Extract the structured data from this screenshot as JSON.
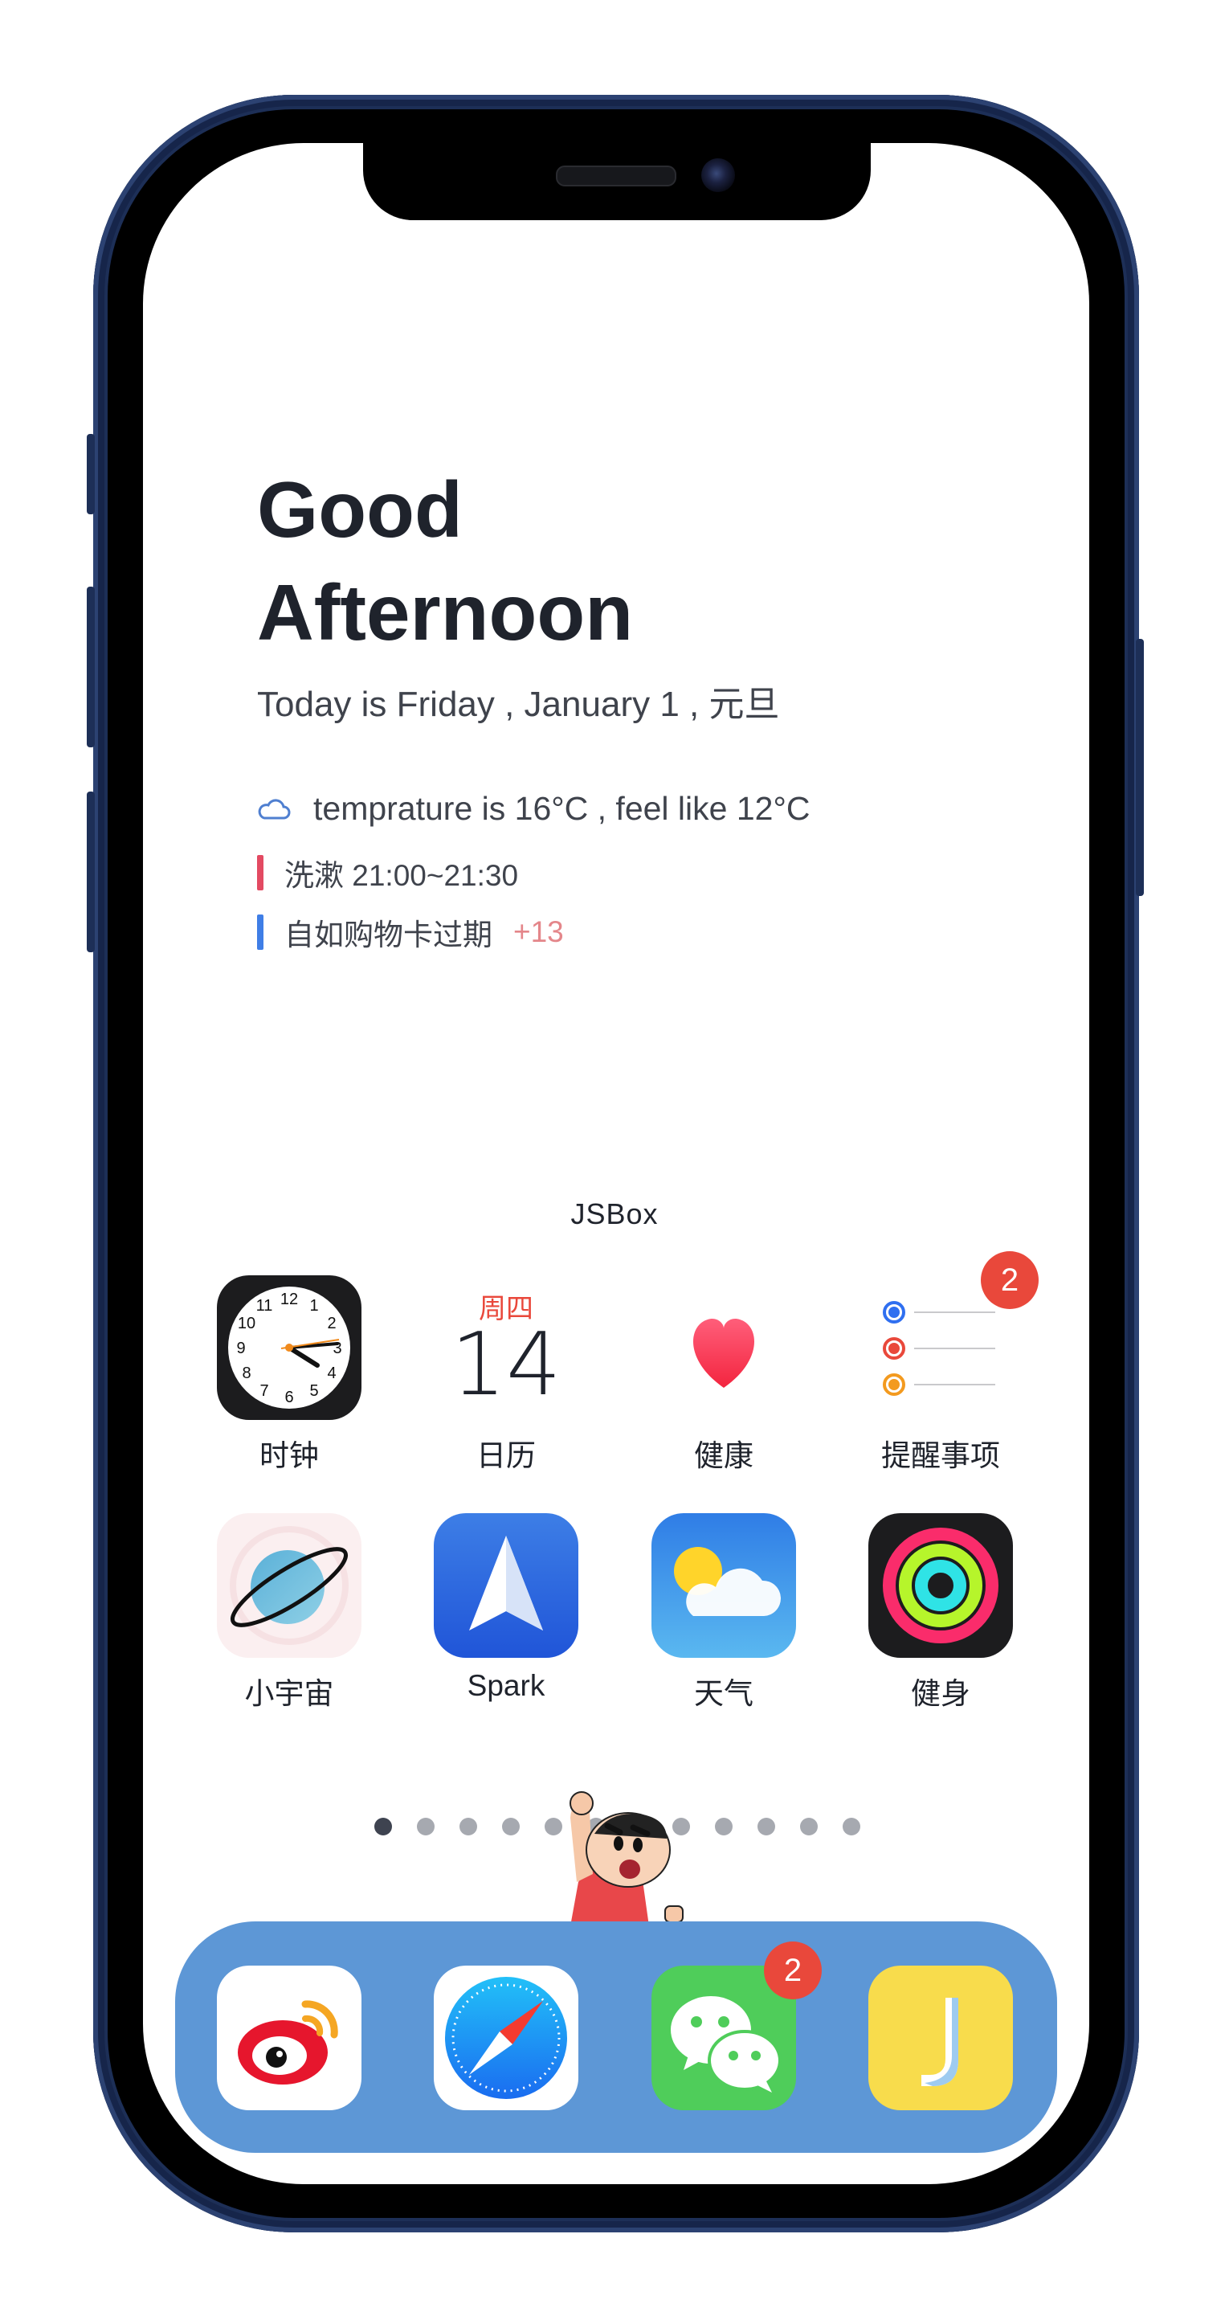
{
  "widget": {
    "greeting_line1": "Good",
    "greeting_line2": "Afternoon",
    "date_text": "Today is Friday , January 1 , 元旦",
    "weather_text": "temprature is 16°C , feel like 12°C",
    "events": [
      {
        "text": "洗漱 21:00~21:30",
        "color": "#e34a62",
        "extra": ""
      },
      {
        "text": "自如购物卡过期",
        "color": "#3f7ee6",
        "extra": "+13"
      }
    ],
    "name": "JSBox"
  },
  "apps": [
    {
      "label": "时钟",
      "icon": "clock-icon"
    },
    {
      "label": "日历",
      "icon": "calendar-icon",
      "calendar_weekday": "周四",
      "calendar_day": "14"
    },
    {
      "label": "健康",
      "icon": "health-heart-icon"
    },
    {
      "label": "提醒事项",
      "icon": "reminders-icon",
      "badge": "2"
    },
    {
      "label": "小宇宙",
      "icon": "planet-icon"
    },
    {
      "label": "Spark",
      "icon": "paper-plane-icon"
    },
    {
      "label": "天气",
      "icon": "weather-icon"
    },
    {
      "label": "健身",
      "icon": "activity-rings-icon"
    }
  ],
  "page_dots": {
    "count": 12,
    "active": 0
  },
  "dock": [
    {
      "icon": "weibo-icon"
    },
    {
      "icon": "safari-compass-icon"
    },
    {
      "icon": "wechat-icon",
      "badge": "2"
    },
    {
      "icon": "j-app-icon"
    }
  ],
  "colors": {
    "frame": "#1d2f57",
    "dock": "#5d97d6",
    "badge": "#e9483b",
    "text": "#1f232c"
  }
}
